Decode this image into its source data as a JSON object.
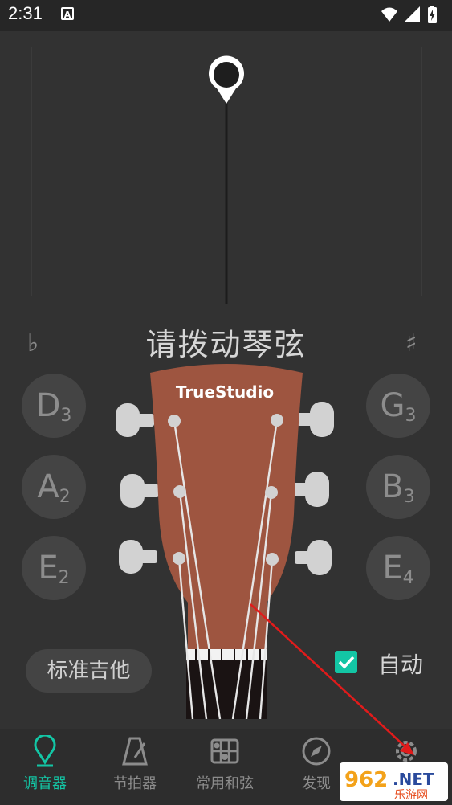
{
  "status": {
    "time": "2:31",
    "notif_icon": "A"
  },
  "tuner": {
    "prompt": "请拨动琴弦",
    "flat_symbol": "♭",
    "sharp_symbol": "♯",
    "brand": "TrueStudio"
  },
  "strings_left": [
    {
      "letter": "D",
      "octave": "3"
    },
    {
      "letter": "A",
      "octave": "2"
    },
    {
      "letter": "E",
      "octave": "2"
    }
  ],
  "strings_right": [
    {
      "letter": "G",
      "octave": "3"
    },
    {
      "letter": "B",
      "octave": "3"
    },
    {
      "letter": "E",
      "octave": "4"
    }
  ],
  "preset": {
    "label": "标准吉他"
  },
  "auto": {
    "label": "自动",
    "checked": true
  },
  "nav": [
    {
      "label": "调音器",
      "icon": "tuner-pin-icon",
      "active": true
    },
    {
      "label": "节拍器",
      "icon": "metronome-icon",
      "active": false
    },
    {
      "label": "常用和弦",
      "icon": "chord-grid-icon",
      "active": false
    },
    {
      "label": "发现",
      "icon": "compass-icon",
      "active": false
    },
    {
      "label": "",
      "icon": "gear-icon",
      "active": false
    }
  ],
  "watermark": {
    "number": "962",
    "suffix": ".NET",
    "sub": "乐游网"
  },
  "colors": {
    "accent": "#13c6a5",
    "headstock": "#9e5540",
    "background": "#323232"
  }
}
